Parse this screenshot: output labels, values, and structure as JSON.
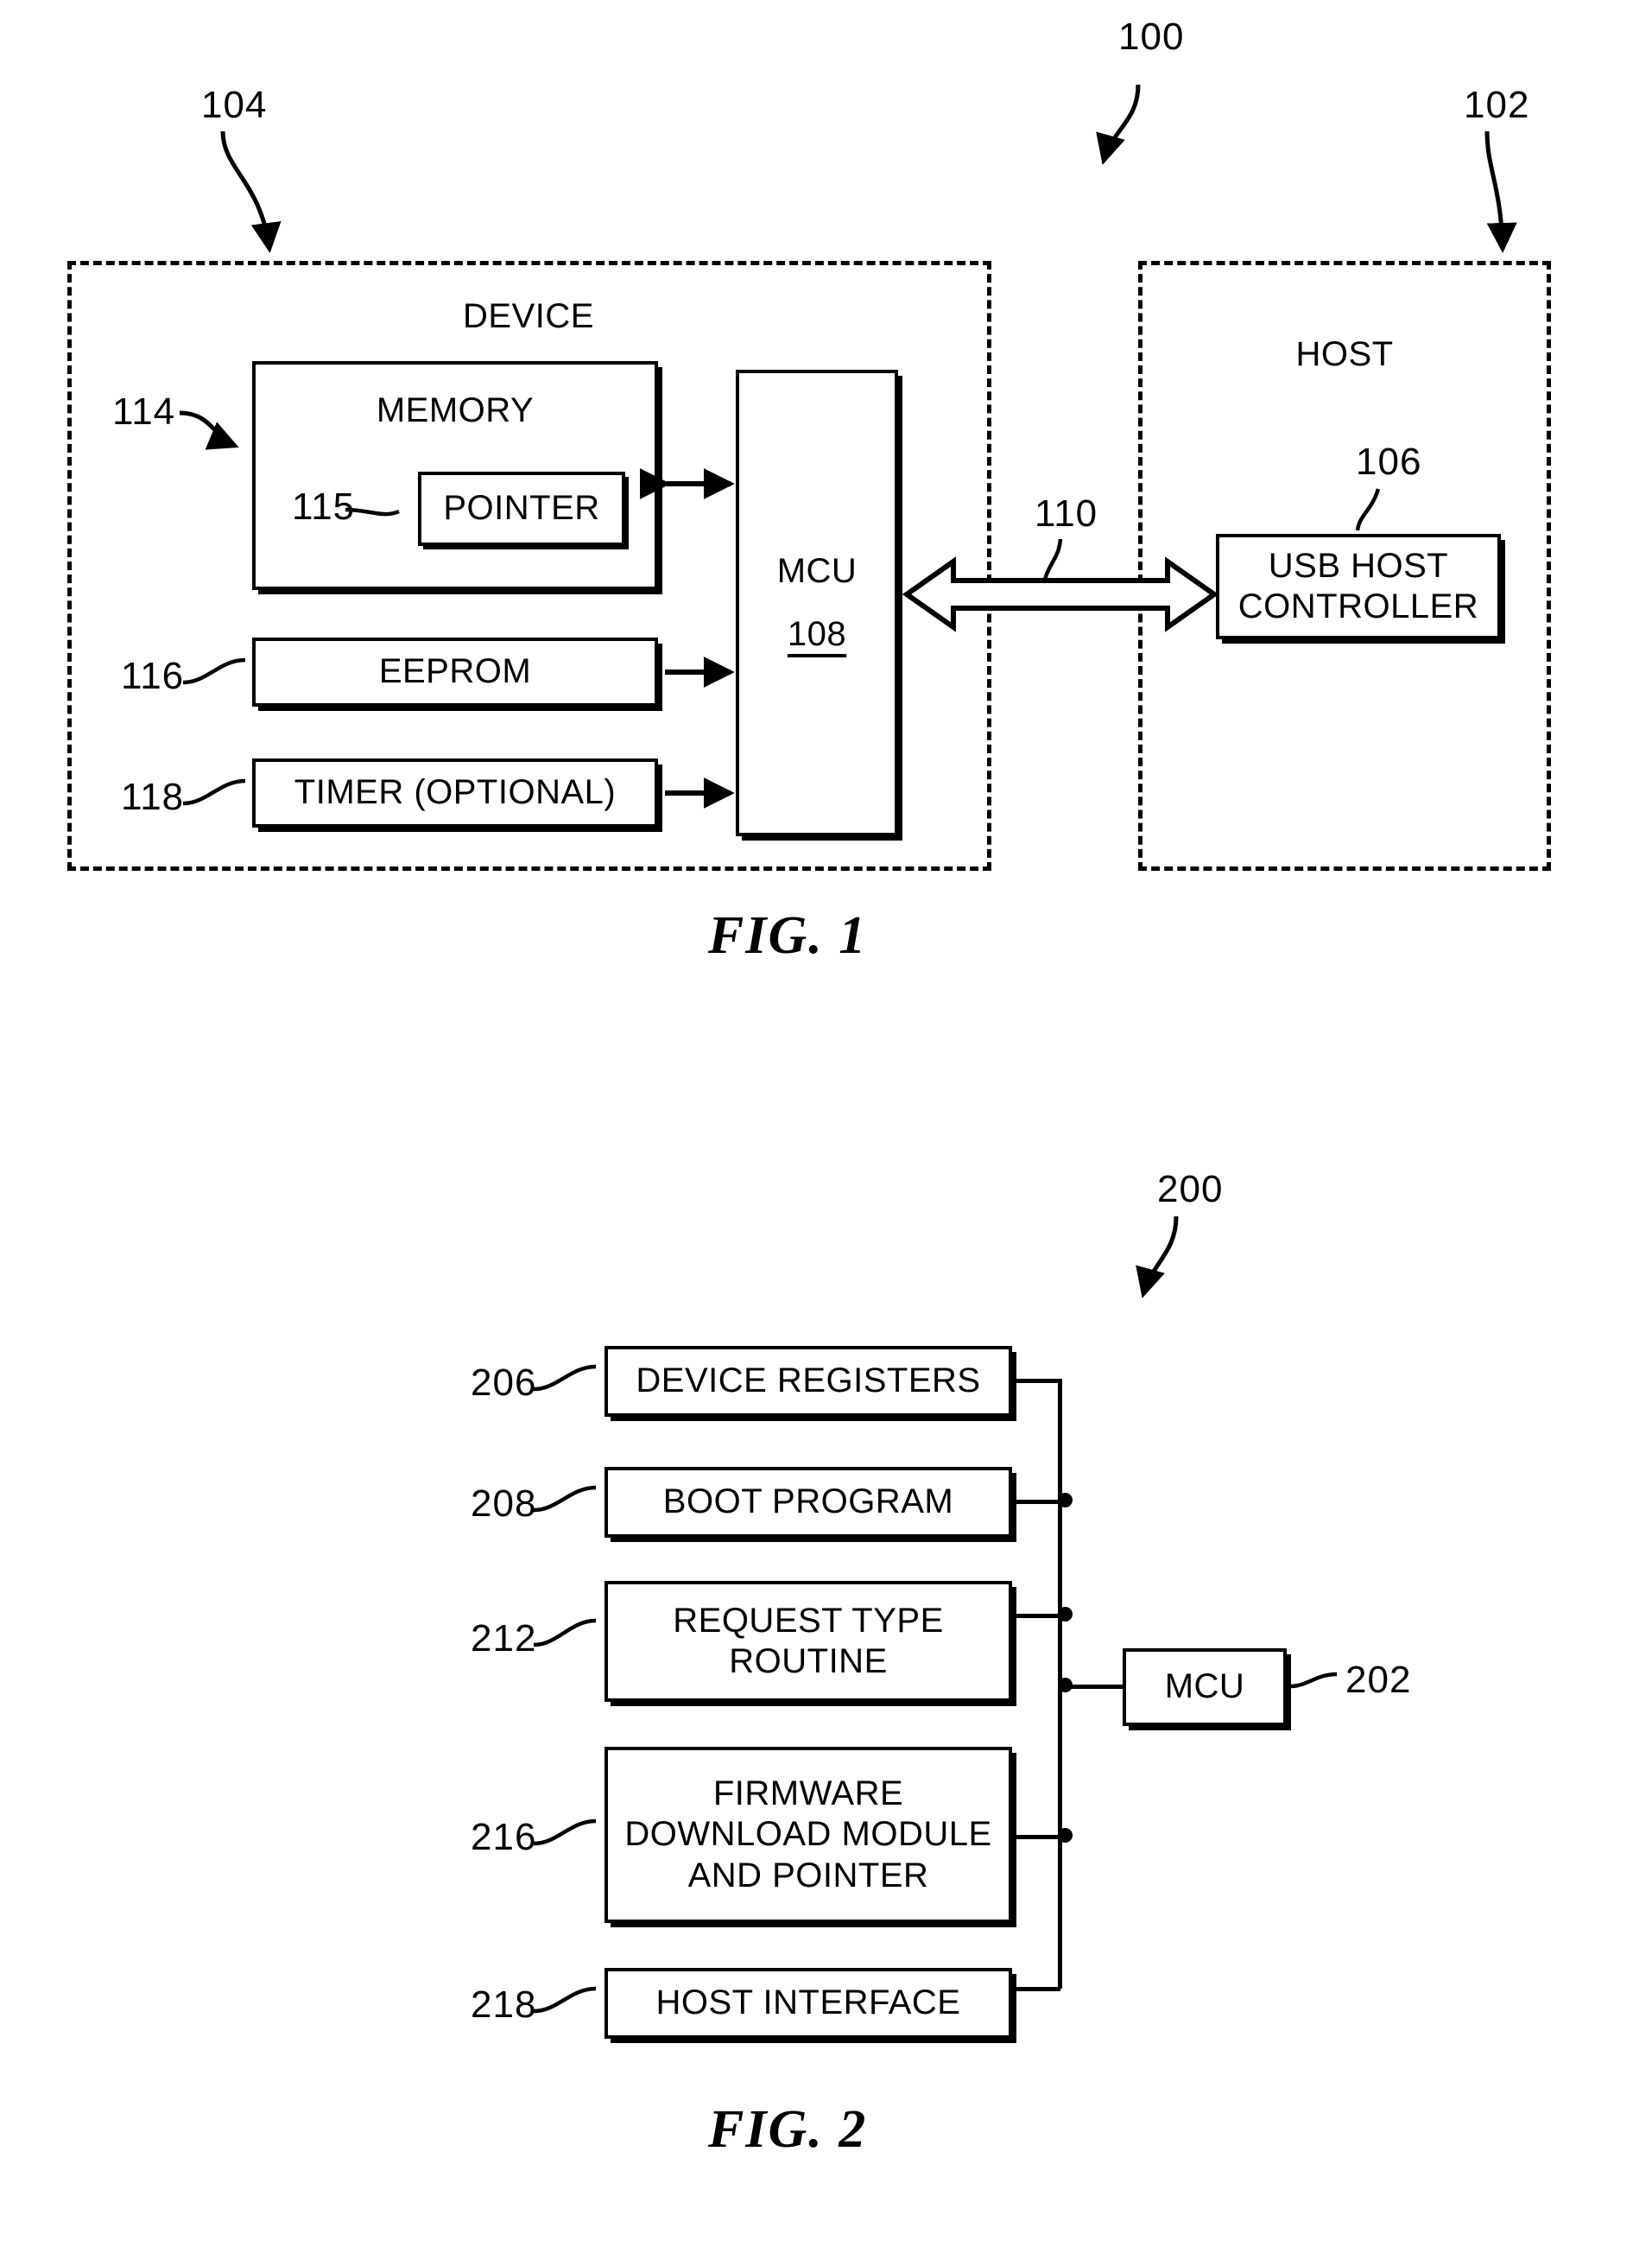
{
  "figure1": {
    "caption": "FIG. 1",
    "system_ref": "100",
    "device": {
      "title": "DEVICE",
      "ref": "104",
      "memory": {
        "label": "MEMORY",
        "ref": "114"
      },
      "pointer": {
        "label": "POINTER",
        "ref": "115"
      },
      "eeprom": {
        "label": "EEPROM",
        "ref": "116"
      },
      "timer": {
        "label": "TIMER (OPTIONAL)",
        "ref": "118"
      },
      "mcu": {
        "label": "MCU",
        "ref": "108"
      }
    },
    "host": {
      "title": "HOST",
      "ref": "102",
      "usb_host_controller": {
        "label_line1": "USB HOST",
        "label_line2": "CONTROLLER",
        "ref": "106"
      }
    },
    "bus": {
      "ref": "110"
    }
  },
  "figure2": {
    "caption": "FIG. 2",
    "system_ref": "200",
    "mcu": {
      "label": "MCU",
      "ref": "202"
    },
    "blocks": [
      {
        "ref": "206",
        "label": "DEVICE REGISTERS"
      },
      {
        "ref": "208",
        "label": "BOOT PROGRAM"
      },
      {
        "ref": "212",
        "label": "REQUEST TYPE\nROUTINE"
      },
      {
        "ref": "216",
        "label": "FIRMWARE\nDOWNLOAD MODULE\nAND POINTER"
      },
      {
        "ref": "218",
        "label": "HOST INTERFACE"
      }
    ]
  }
}
